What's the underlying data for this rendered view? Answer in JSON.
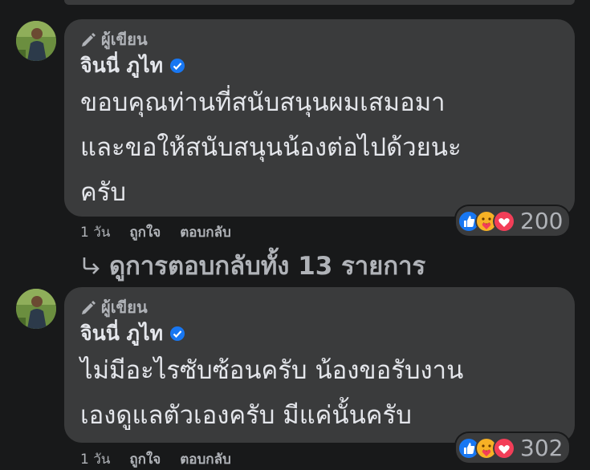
{
  "comments": [
    {
      "badge": "ผู้เขียน",
      "author": "จินนี่ ภูไท",
      "lines": [
        "ขอบคุณท่านที่สนับสนุนผมเสมอมา",
        "และขอให้สนับสนุนน้องต่อไปด้วยนะ",
        "ครับ"
      ],
      "reaction_count": "200",
      "time": "1 วัน",
      "like_label": "ถูกใจ",
      "reply_label": "ตอบกลับ",
      "reactions": [
        "like-icon",
        "care-icon",
        "love-icon"
      ]
    },
    {
      "badge": "ผู้เขียน",
      "author": "จินนี่ ภูไท",
      "lines": [
        "ไม่มีอะไรซับซ้อนครับ น้องขอรับงาน",
        "เองดูแลตัวเองครับ มีแค่นั้นครับ"
      ],
      "reaction_count": "302",
      "time": "1 วัน",
      "like_label": "ถูกใจ",
      "reply_label": "ตอบกลับ",
      "reactions": [
        "like-icon",
        "care-icon",
        "love-icon"
      ]
    }
  ],
  "view_replies": "ดูการตอบกลับทั้ง 13 รายการ",
  "colors": {
    "background": "#18191a",
    "bubble": "#3a3b3c",
    "text_primary": "#e4e6eb",
    "text_secondary": "#b0b3b8",
    "verified_blue": "#1877f2",
    "like_blue": "#1877f2",
    "love_red": "#f33e58",
    "care_yellow": "#f7b125"
  }
}
